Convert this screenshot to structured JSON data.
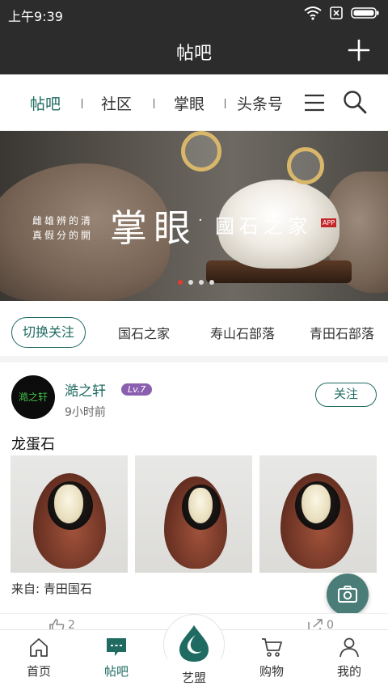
{
  "status_bar": {
    "time": "上午9:39"
  },
  "header": {
    "title": "帖吧"
  },
  "tabs": [
    {
      "label": "帖吧",
      "active": true
    },
    {
      "label": "社区",
      "active": false
    },
    {
      "label": "掌眼",
      "active": false
    },
    {
      "label": "头条号",
      "active": false
    }
  ],
  "banner": {
    "verse_line1": "雌雄辨的清",
    "verse_line2": "真假分的開",
    "brand": "掌眼",
    "separator": "·",
    "subtitle": "國石之家",
    "tag": "APP",
    "slide_count": 4,
    "active_slide": 1
  },
  "channels": {
    "switch_label": "切换关注",
    "items": [
      "国石之家",
      "寿山石部落",
      "青田石部落"
    ]
  },
  "post": {
    "avatar_text": "澔之轩",
    "author": "澔之轩",
    "level": "Lv.7",
    "time": "9小时前",
    "follow_label": "关注",
    "title": "龙蛋石",
    "source_prefix": "来自:",
    "source_name": "青田国石",
    "likes": "2",
    "shares": "0"
  },
  "bottom_nav": {
    "items": [
      {
        "label": "首页",
        "icon": "home-icon"
      },
      {
        "label": "帖吧",
        "icon": "forum-icon"
      },
      {
        "label": "艺盟",
        "icon": "drop-logo-icon"
      },
      {
        "label": "购物",
        "icon": "cart-icon"
      },
      {
        "label": "我的",
        "icon": "profile-icon"
      }
    ],
    "active": "帖吧"
  },
  "colors": {
    "accent": "#1f6b62",
    "header_bg": "#2c2c2c",
    "level_badge": "#8b5fb0",
    "fab": "#4b7d78",
    "banner_dot_active": "#e53935"
  }
}
